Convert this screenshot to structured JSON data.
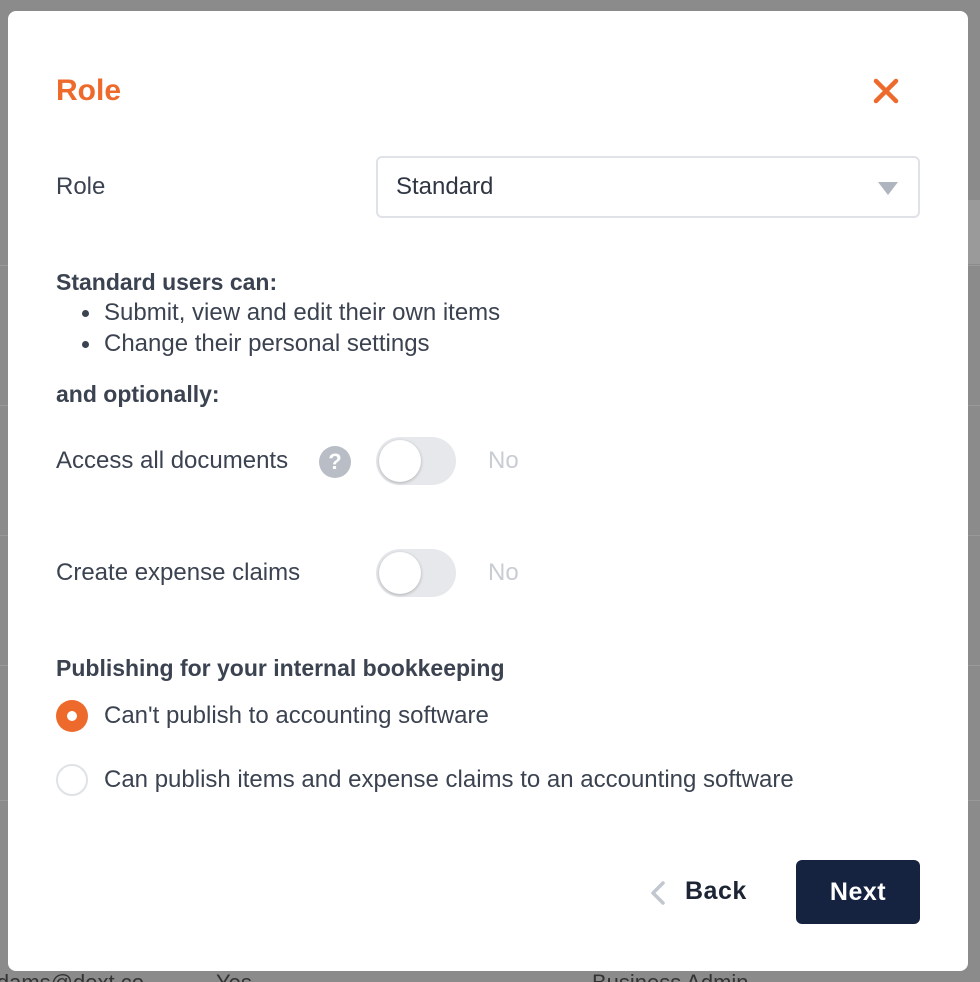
{
  "modal": {
    "title": "Role",
    "close_icon": "close-icon",
    "role_label": "Role",
    "role_select": {
      "value": "Standard",
      "caret_icon": "caret-down-icon"
    },
    "capabilities_heading": "Standard users can:",
    "capabilities": [
      "Submit, view and edit their own items",
      "Change their personal settings"
    ],
    "optional_heading": "and optionally:",
    "options": [
      {
        "label": "Access all documents",
        "has_help": true,
        "help_icon": "help-icon",
        "enabled": false,
        "state_text": "No"
      },
      {
        "label": "Create expense claims",
        "has_help": false,
        "enabled": false,
        "state_text": "No"
      }
    ],
    "publishing_heading": "Publishing for your internal bookkeeping",
    "publishing_options": [
      {
        "label": "Can't publish to accounting software",
        "selected": true
      },
      {
        "label": "Can publish items and expense claims to an accounting software",
        "selected": false
      }
    ],
    "back_label": "Back",
    "next_label": "Next"
  },
  "background": {
    "bottom_row": [
      "ldams@dext.co",
      "Yes",
      "Business Admin"
    ]
  },
  "colors": {
    "accent": "#ee6a2c",
    "primary_button": "#152340",
    "text": "#3b4250",
    "muted": "#c9cdd3"
  }
}
